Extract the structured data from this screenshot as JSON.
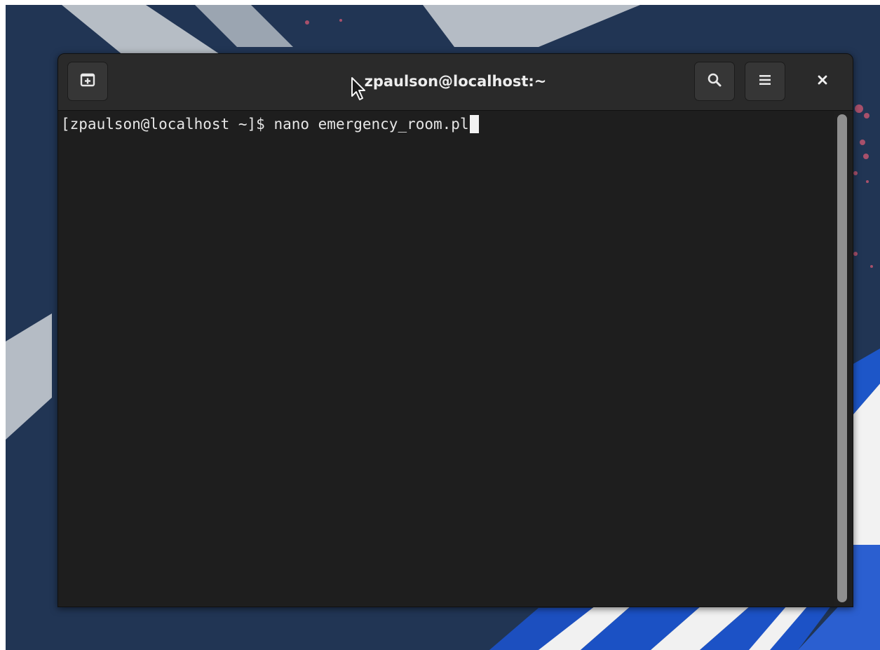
{
  "window": {
    "title": "zpaulson@localhost:~"
  },
  "headerbar": {
    "new_tab_icon": "new-tab-icon",
    "search_icon": "search-icon",
    "menu_icon": "hamburger-menu-icon",
    "close_icon": "close-icon"
  },
  "terminal": {
    "prompt": "[zpaulson@localhost ~]$ ",
    "command": "nano emergency_room.pl"
  },
  "colors": {
    "desktop_background": "#213554",
    "headerbar": "#2a2a2a",
    "terminal_background": "#1e1e1e",
    "terminal_text": "#e6e6e6",
    "scrollbar_thumb": "#8f8f8f"
  }
}
